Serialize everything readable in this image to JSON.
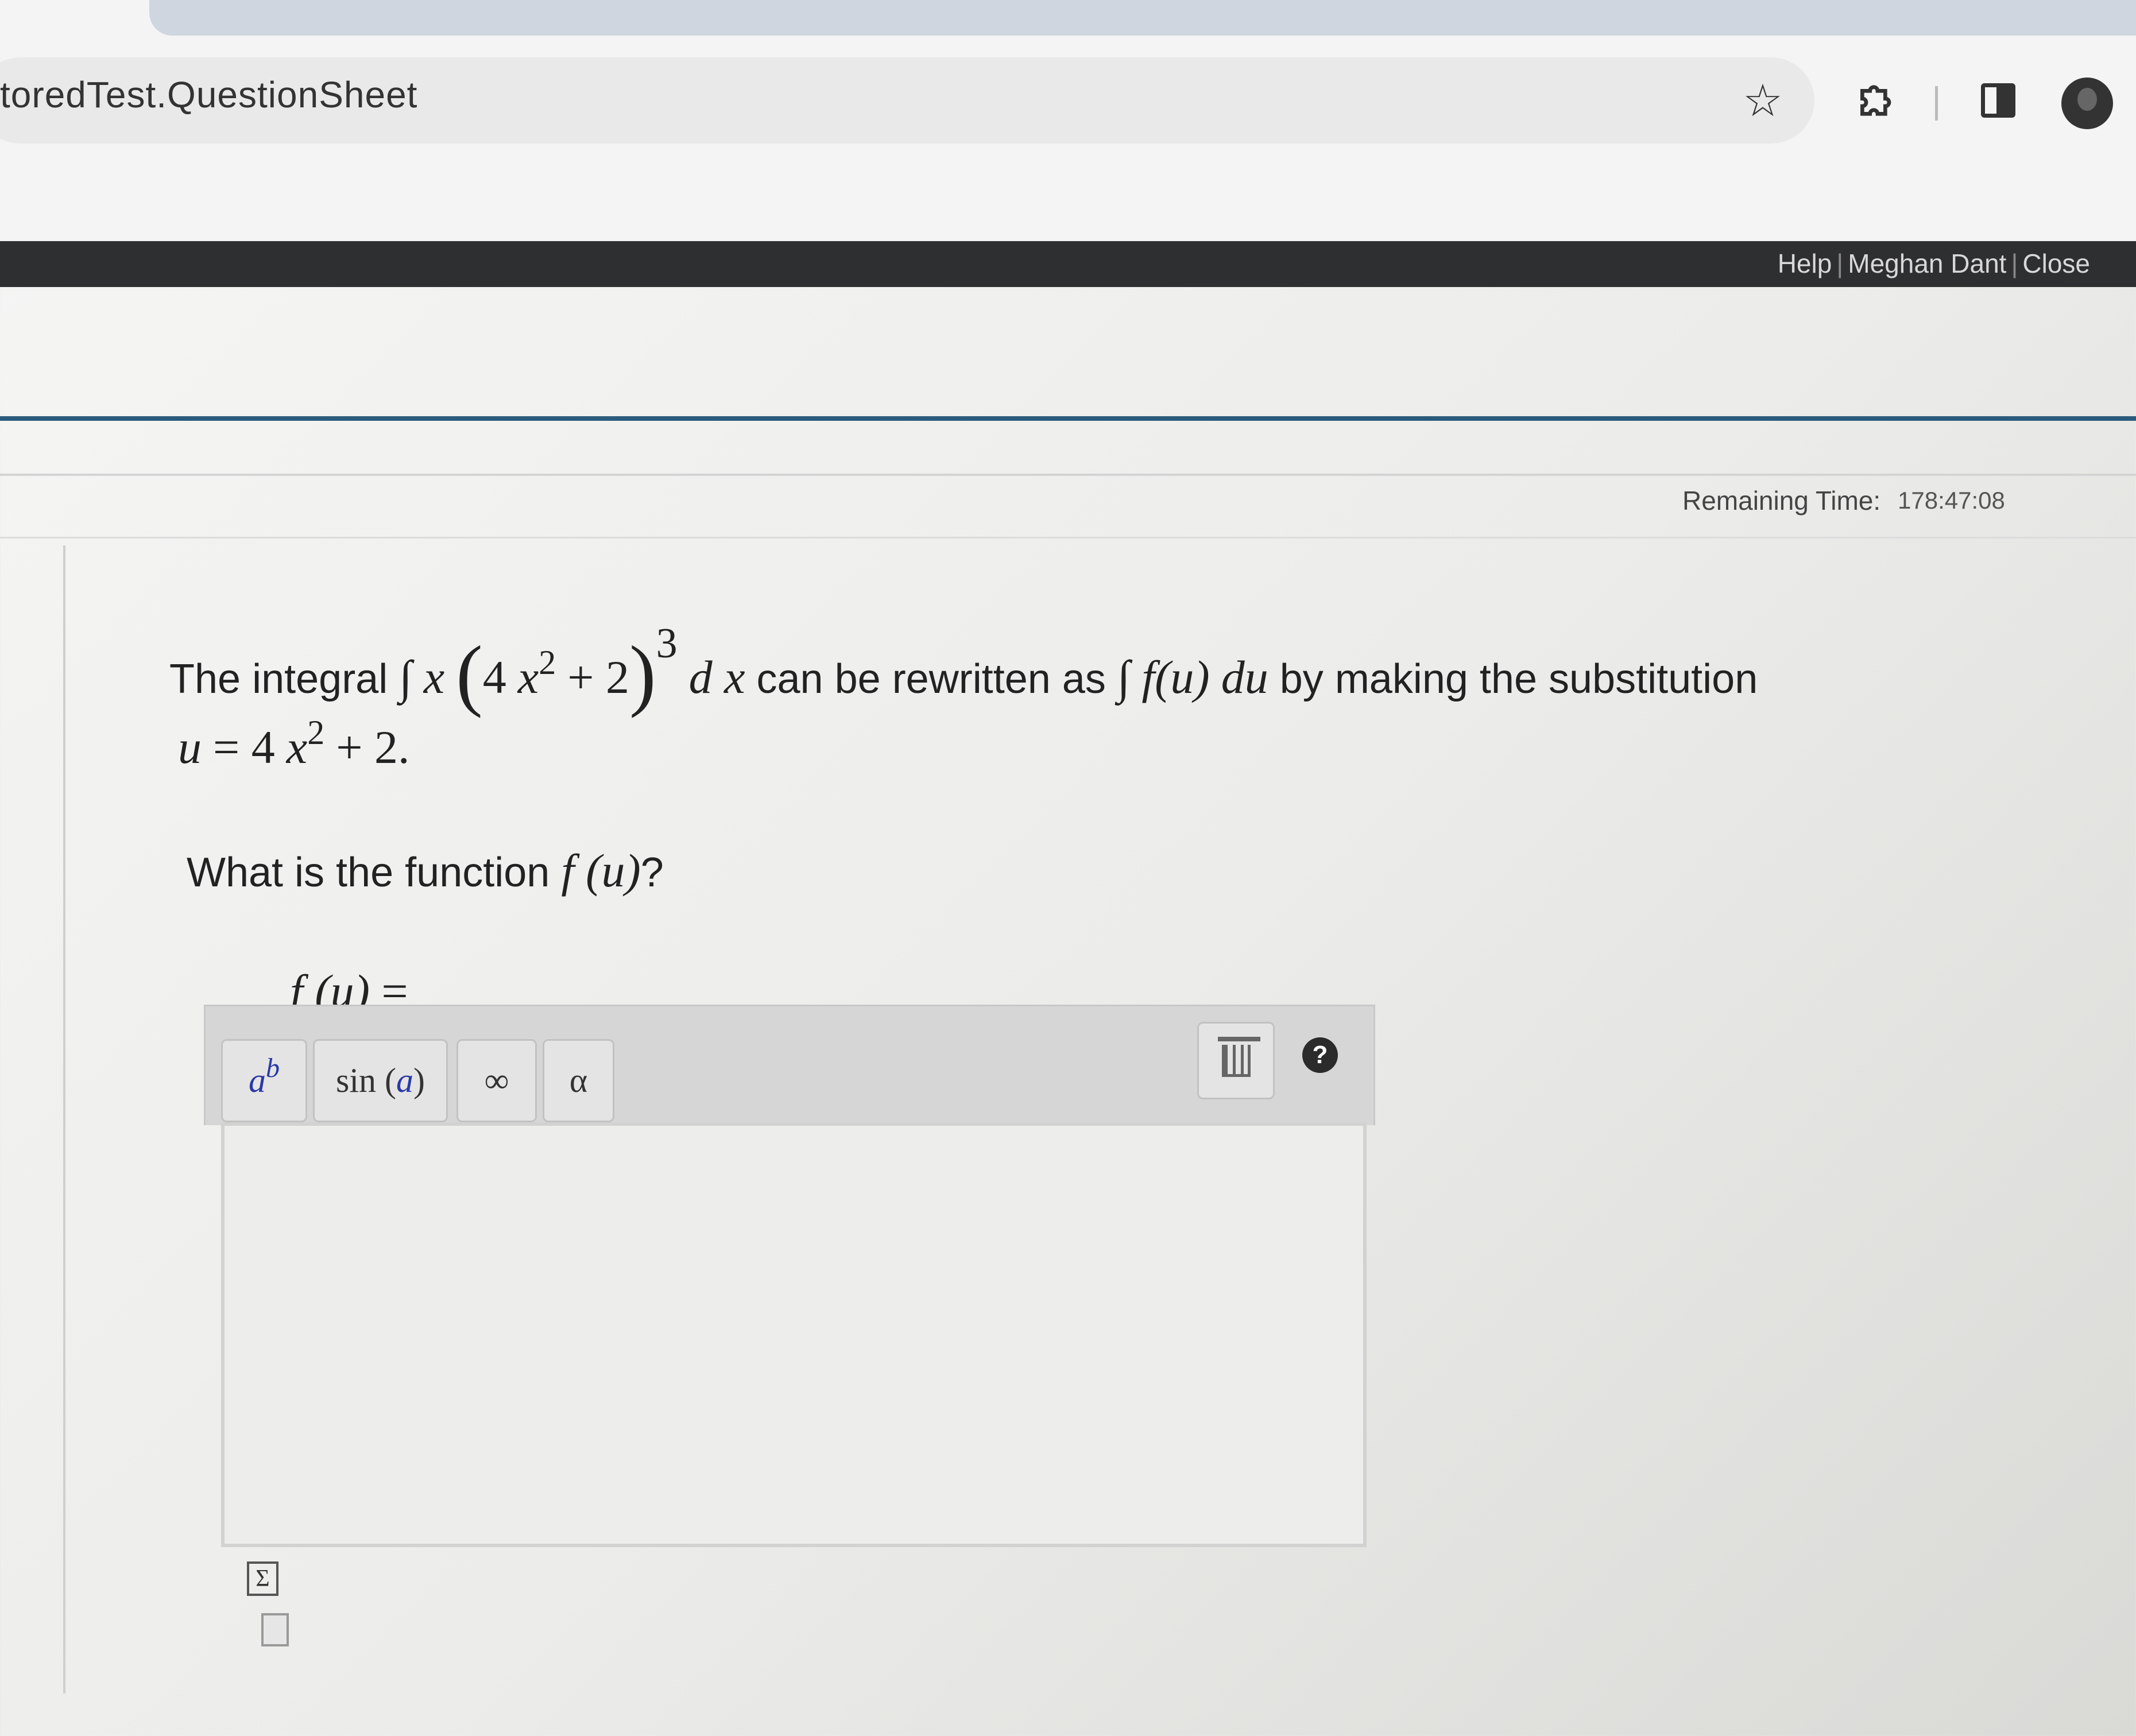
{
  "browser": {
    "address_text": "toredTest.QuestionSheet"
  },
  "header": {
    "help": "Help",
    "separator": "|",
    "user_name": "Meghan Dant",
    "close": "Close"
  },
  "timer": {
    "label": "Remaining Time:",
    "value": "178:47:08"
  },
  "question": {
    "intro": "The integral",
    "integral_sign": "∫",
    "var_x": "x",
    "coef": "4",
    "exp2": "2",
    "plus_two": "+ 2",
    "cube": "3",
    "dx": "d x",
    "mid_text": "can be rewritten as",
    "fu": "f(u)",
    "du": "du",
    "end_text": "by making the substitution",
    "sub_u": "u",
    "sub_equals": "= 4",
    "sub_x": "x",
    "sub_exp": "2",
    "sub_end": "+ 2.",
    "prompt": "What is the function",
    "prompt_f": "f",
    "prompt_u": "(u)",
    "prompt_q": "?"
  },
  "answer": {
    "label_f": "f",
    "label_u": "(u)",
    "label_eq": "="
  },
  "toolbar": {
    "power_base": "a",
    "power_exp": "b",
    "sin_fn": "sin",
    "sin_open": "(",
    "sin_arg": "a",
    "sin_close": ")",
    "infinity": "∞",
    "alpha": "α",
    "help": "?"
  },
  "icons": {
    "star": "star-icon",
    "extensions": "puzzle-icon",
    "sidepanel": "sidepanel-icon",
    "avatar": "avatar-icon",
    "trash": "trash-icon",
    "help": "help-icon",
    "equation_editor": "sigma-document-icon",
    "document": "document-icon"
  },
  "icon_glyphs": {
    "sigma": "Σ"
  },
  "colors": {
    "header_bar": "#2d2f31",
    "accent_rule": "#2a5b7c",
    "math_blue": "#2a39a8"
  }
}
